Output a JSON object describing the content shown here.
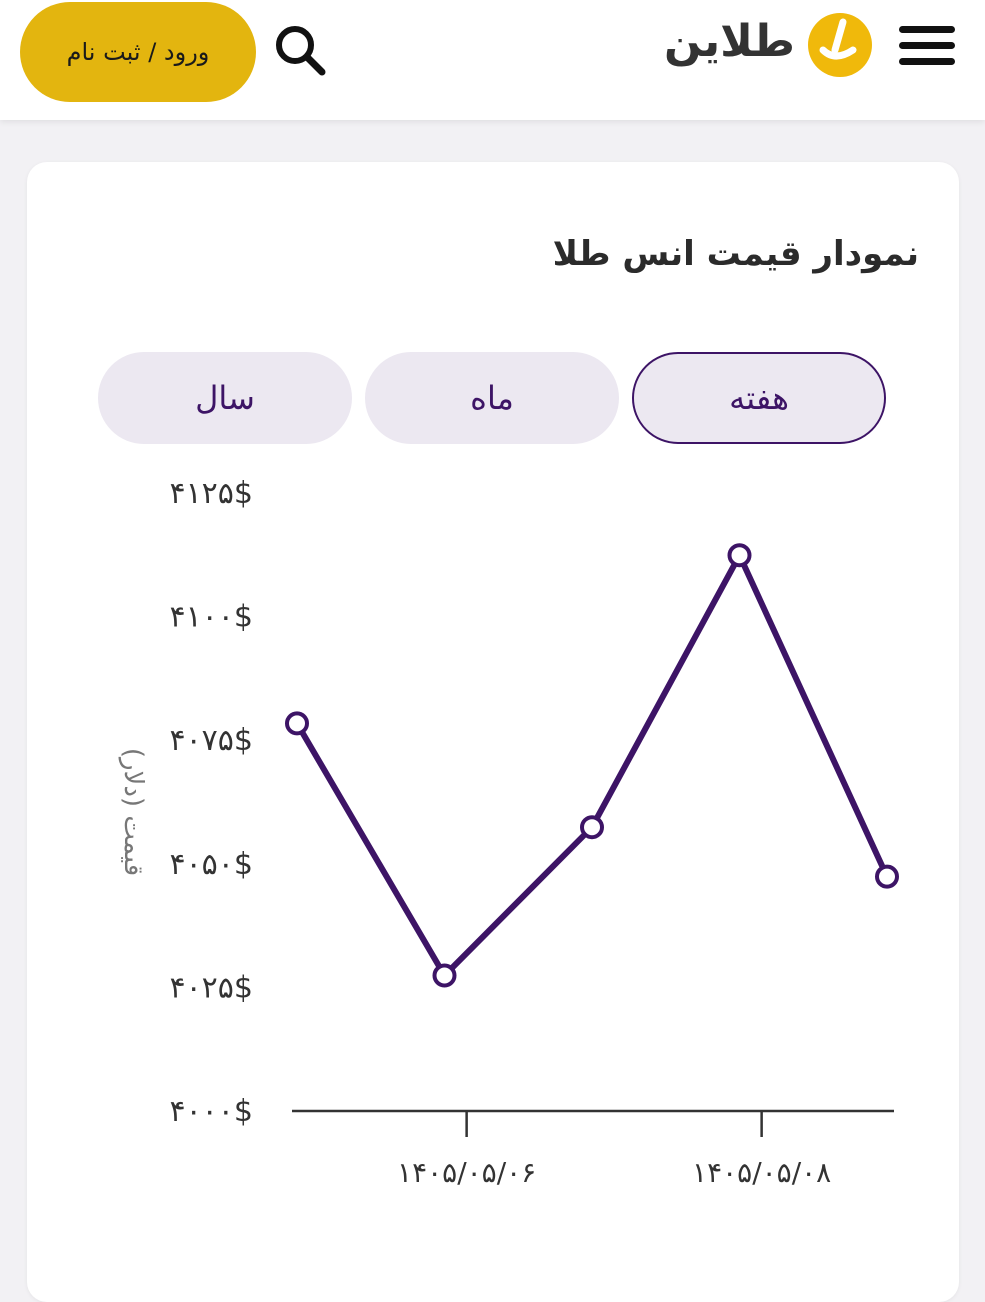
{
  "header": {
    "logo_text": "طلاین",
    "login_label": "ورود / ثبت نام",
    "menu_icon": "hamburger-menu-icon",
    "search_icon": "search-icon",
    "accent_color": "#e3b50f"
  },
  "card": {
    "title": "نمودار قیمت انس طلا",
    "tabs": [
      {
        "label": "هفته",
        "active": true
      },
      {
        "label": "ماه",
        "active": false
      },
      {
        "label": "سال",
        "active": false
      }
    ]
  },
  "chart_data": {
    "type": "line",
    "ylabel": "قیمت (دلار)",
    "ylim": [
      4000,
      4125
    ],
    "y_ticks": [
      {
        "value": 4125,
        "label": "۴۱۲۵$"
      },
      {
        "value": 4100,
        "label": "۴۱۰۰$"
      },
      {
        "value": 4075,
        "label": "۴۰۷۵$"
      },
      {
        "value": 4050,
        "label": "۴۰۵۰$"
      },
      {
        "value": 4025,
        "label": "۴۰۲۵$"
      },
      {
        "value": 4000,
        "label": "۴۰۰۰$"
      }
    ],
    "x_ticks": [
      {
        "index": 1.15,
        "label": "۱۴۰۵/۰۵/۰۶"
      },
      {
        "index": 3.15,
        "label": "۱۴۰۵/۰۵/۰۸"
      }
    ],
    "series": [
      {
        "values": [
          4078,
          4027,
          4057,
          4112,
          4047
        ]
      }
    ],
    "line_color": "#3d1466",
    "grid": false
  }
}
